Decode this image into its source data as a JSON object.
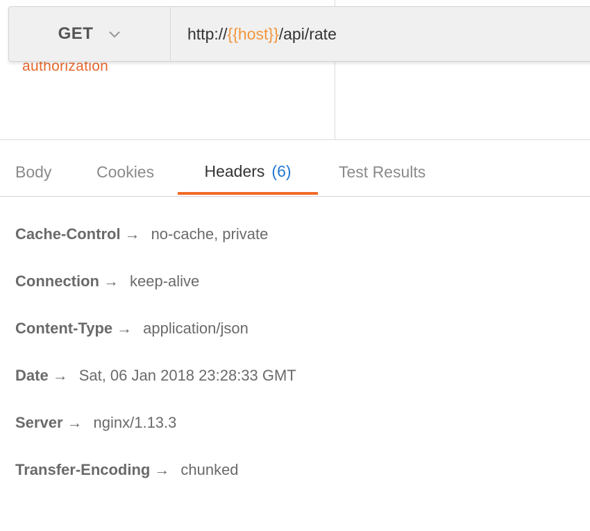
{
  "request": {
    "clipped_link_text": "authorization",
    "method": "GET",
    "url": {
      "prefix": "http://",
      "variable": "{{host}}",
      "suffix": "/api/rate"
    }
  },
  "response": {
    "tabs": [
      {
        "label": "Body"
      },
      {
        "label": "Cookies"
      },
      {
        "label": "Headers",
        "count": "(6)",
        "active": true
      },
      {
        "label": "Test Results"
      }
    ],
    "headers": [
      {
        "key": "Cache-Control",
        "arrow": "→",
        "value": "no-cache, private"
      },
      {
        "key": "Connection",
        "arrow": "→",
        "value": "keep-alive"
      },
      {
        "key": "Content-Type",
        "arrow": "→",
        "value": "application/json"
      },
      {
        "key": "Date",
        "arrow": "→",
        "value": "Sat, 06 Jan 2018 23:28:33 GMT"
      },
      {
        "key": "Server",
        "arrow": "→",
        "value": "nginx/1.13.3"
      },
      {
        "key": "Transfer-Encoding",
        "arrow": "→",
        "value": "chunked"
      }
    ]
  },
  "colors": {
    "accent_tab": "#f06a26",
    "variable": "#f3963b",
    "count": "#1f78d1"
  },
  "icons": {
    "method_dropdown": "chevron-down-icon"
  }
}
